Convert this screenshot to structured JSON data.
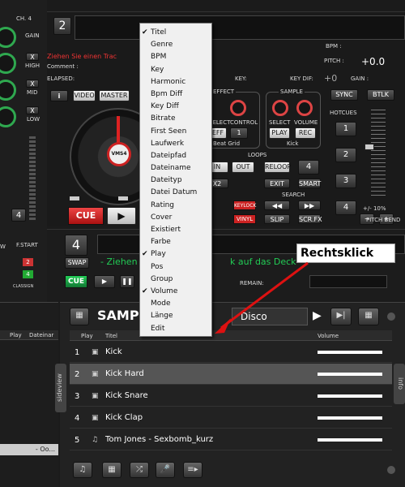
{
  "deck_left": {
    "channel": "CH. 4",
    "gain": "GAIN",
    "high": "HIGH",
    "mid": "MID",
    "low": "LOW",
    "x1": "X",
    "x2": "X",
    "x3": "X",
    "deck_number": "2",
    "drag_hint": "Ziehen Sie einen Trac",
    "comment": "Comment :",
    "elapsed": "ELAPSED:",
    "key": "KEY:",
    "info_btn": "i",
    "video_btn": "VIDEO",
    "master_btn": "MASTER",
    "platter_logo": "VMS4",
    "cue": "CUE",
    "play": "▶",
    "num4": "4",
    "fstart": "F.START",
    "s2": "2",
    "s4": "4",
    "classign": "CLASSIGN",
    "w": "W"
  },
  "deck_right": {
    "bpm": "BPM :",
    "pitch": "PITCH :",
    "pitch_val": "+0.0",
    "keydif": "KEY DIF:",
    "keydif_val": "+0",
    "gain": "GAIN :",
    "effect": "EFFECT",
    "select": "SELECT",
    "control": "CONTROL",
    "eff_btn": "EFF",
    "one": "1",
    "beat_grid": "Beat Grid",
    "sample": "SAMPLE",
    "s_select": "SELECT",
    "s_volume": "VOLUME",
    "s_play": "PLAY",
    "s_rec": "REC",
    "kick": "Kick",
    "sync": "SYNC",
    "btlk": "BTLK",
    "hotcues": "HOTCUES",
    "h1": "1",
    "h2": "2",
    "h3": "3",
    "h4": "4",
    "loops": "LOOPS",
    "in": "IN",
    "out": "OUT",
    "reloop": "RELOOP",
    "l4": "4",
    "x2": "X2",
    "exit": "EXIT",
    "smart": "SMART",
    "search": "SEARCH",
    "keylock": "KEYLOCK",
    "vinyl": "VINYL",
    "slip": "SLIP",
    "scrfx": "SCR.FX",
    "range": "+/- 10%",
    "pitch_bend": "PITCH BEND"
  },
  "deck_bottom": {
    "num": "4",
    "swap": "SWAP",
    "cue": "CUE",
    "drop_hint": "- Ziehen",
    "drop_hint2": "k auf das Deck",
    "remain": "REMAIN:"
  },
  "context_menu": {
    "items": [
      {
        "label": "Titel",
        "checked": true
      },
      {
        "label": "Genre",
        "checked": false
      },
      {
        "label": "BPM",
        "checked": false
      },
      {
        "label": "Key",
        "checked": false
      },
      {
        "label": "Harmonic",
        "checked": false
      },
      {
        "label": "Bpm Diff",
        "checked": false
      },
      {
        "label": "Key Diff",
        "checked": false
      },
      {
        "label": "Bitrate",
        "checked": false
      },
      {
        "label": "First Seen",
        "checked": false
      },
      {
        "label": "Laufwerk",
        "checked": false
      },
      {
        "label": "Dateipfad",
        "checked": false
      },
      {
        "label": "Dateiname",
        "checked": false
      },
      {
        "label": "Dateityp",
        "checked": false
      },
      {
        "label": "Datei Datum",
        "checked": false
      },
      {
        "label": "Rating",
        "checked": false
      },
      {
        "label": "Cover",
        "checked": false
      },
      {
        "label": "Existiert",
        "checked": false
      },
      {
        "label": "Farbe",
        "checked": false
      },
      {
        "label": "Play",
        "checked": true
      },
      {
        "label": "Pos",
        "checked": false
      },
      {
        "label": "Group",
        "checked": false
      },
      {
        "label": "Volume",
        "checked": true
      },
      {
        "label": "Mode",
        "checked": false
      },
      {
        "label": "Länge",
        "checked": false
      },
      {
        "label": "Edit",
        "checked": false
      }
    ]
  },
  "annotation": {
    "label": "Rechtsklick"
  },
  "browser": {
    "folder_title": "SAMP",
    "filter": "Disco",
    "col_play": "Play",
    "col_title": "Titel",
    "col_volume": "Volume",
    "rows": [
      {
        "n": "1",
        "title": "Kick",
        "icon": "▣",
        "volume": 1.0
      },
      {
        "n": "2",
        "title": "Kick Hard",
        "icon": "▣",
        "volume": 1.0
      },
      {
        "n": "3",
        "title": "Kick Snare",
        "icon": "▣",
        "volume": 1.0
      },
      {
        "n": "4",
        "title": "Kick Clap",
        "icon": "▣",
        "volume": 1.0
      },
      {
        "n": "5",
        "title": "Tom Jones - Sexbomb_kurz",
        "icon": "♫",
        "volume": 1.0
      }
    ],
    "sideview": "sideview",
    "info": "info"
  },
  "left_browser": {
    "col_play": "Play",
    "col_file": "Dateinar",
    "footer": "- Oo..."
  }
}
